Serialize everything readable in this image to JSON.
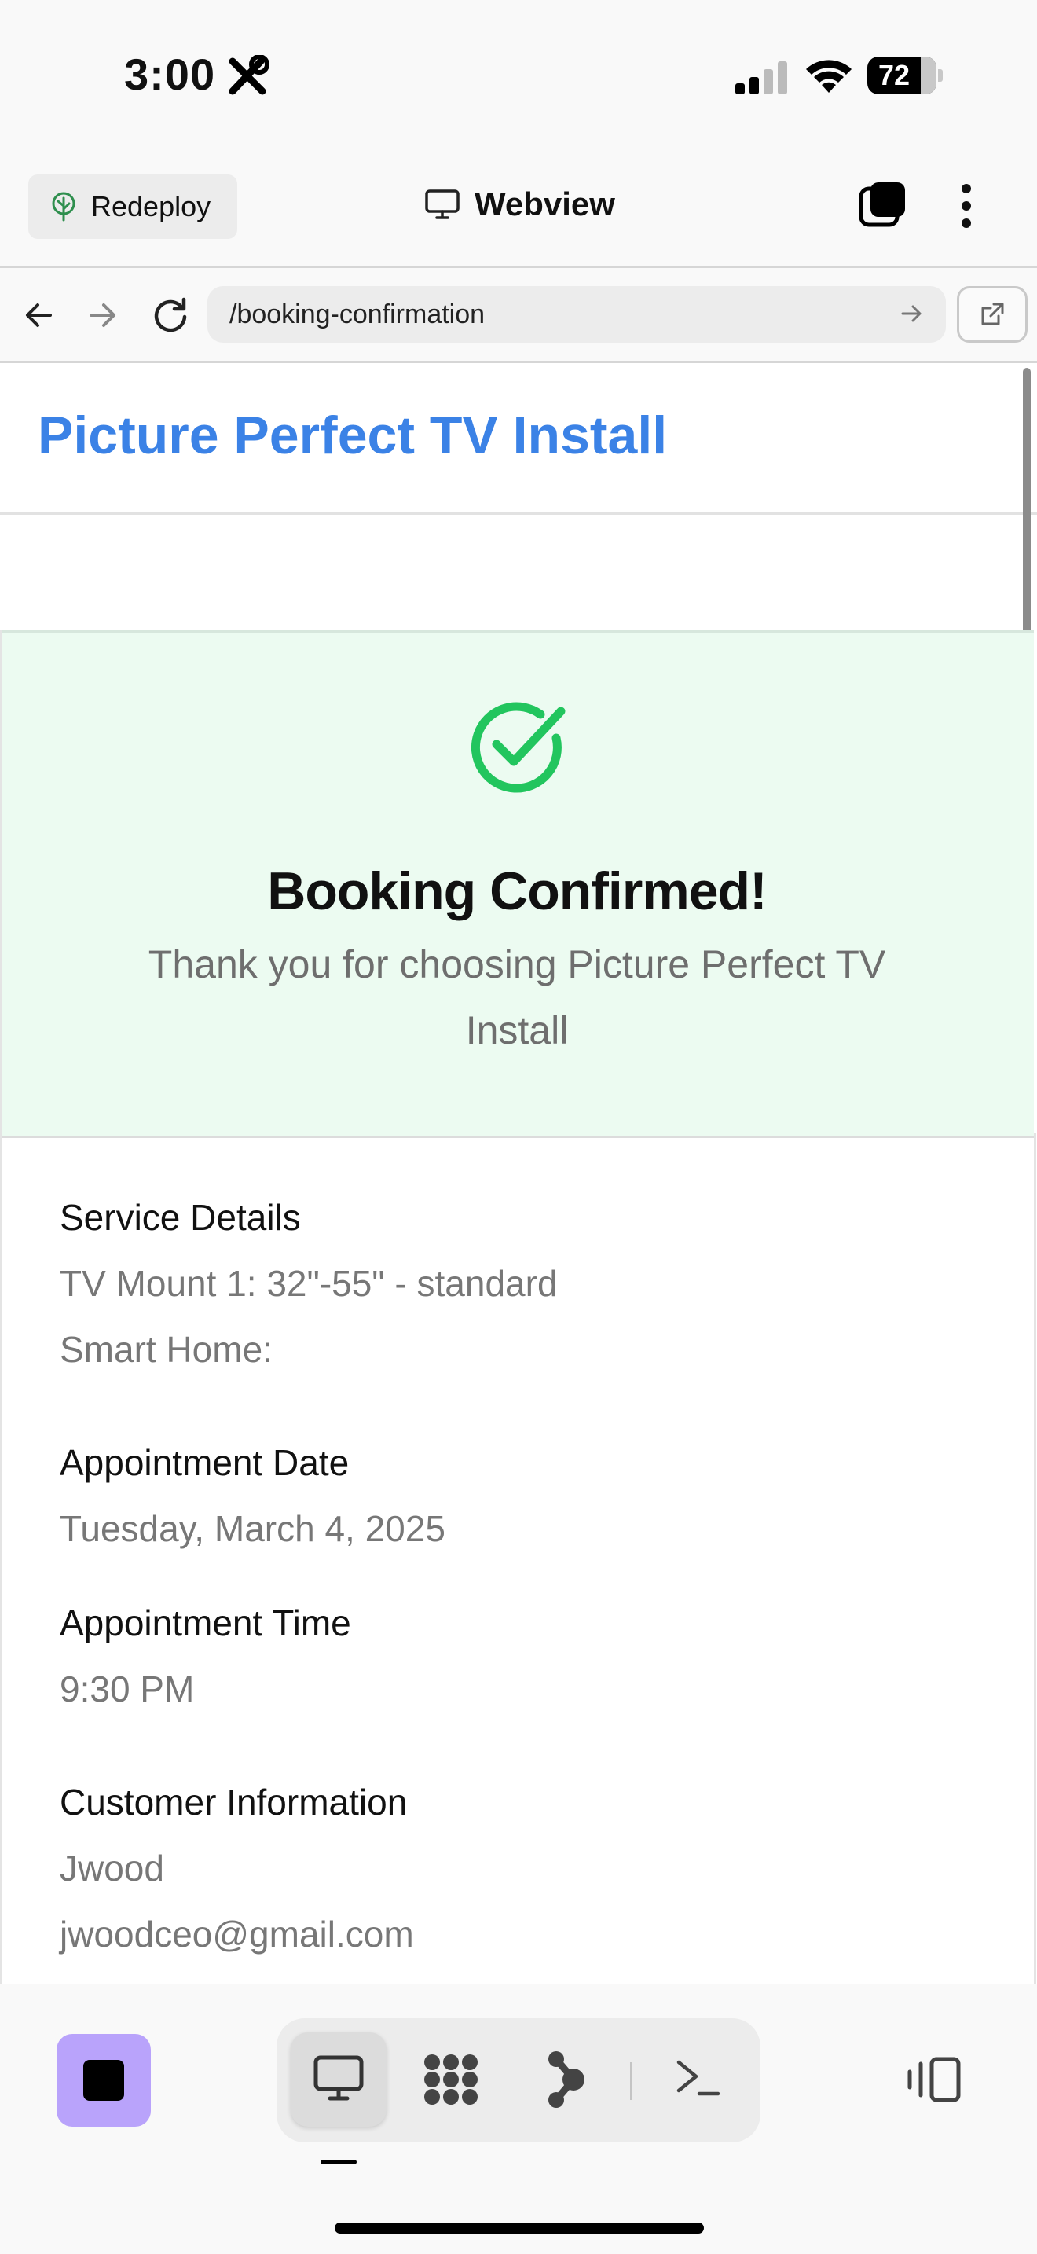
{
  "status_bar": {
    "time": "3:00",
    "battery": "72"
  },
  "app_bar": {
    "redeploy_label": "Redeploy",
    "title": "Webview"
  },
  "url_bar": {
    "path": "/booking-confirmation"
  },
  "page": {
    "site_title": "Picture Perfect TV Install",
    "banner": {
      "title": "Booking Confirmed!",
      "subtitle": "Thank you for choosing Picture Perfect TV Install",
      "accent_color": "#22c55e"
    },
    "service_details": {
      "label": "Service Details",
      "items": [
        "TV Mount 1: 32\"-55\" - standard",
        "Smart Home:"
      ]
    },
    "appointment_date": {
      "label": "Appointment Date",
      "value": "Tuesday, March 4, 2025"
    },
    "appointment_time": {
      "label": "Appointment Time",
      "value": "9:30 PM"
    },
    "customer_info": {
      "label": "Customer Information",
      "name": "Jwood",
      "email": "jwoodceo@gmail.com"
    }
  },
  "icons": {
    "status": [
      "tools-icon",
      "signal-icon",
      "wifi-icon",
      "battery-icon"
    ],
    "toolbar": [
      "desktop-icon",
      "apps-icon",
      "agent-icon",
      "terminal-icon",
      "panel-toggle-icon"
    ]
  }
}
